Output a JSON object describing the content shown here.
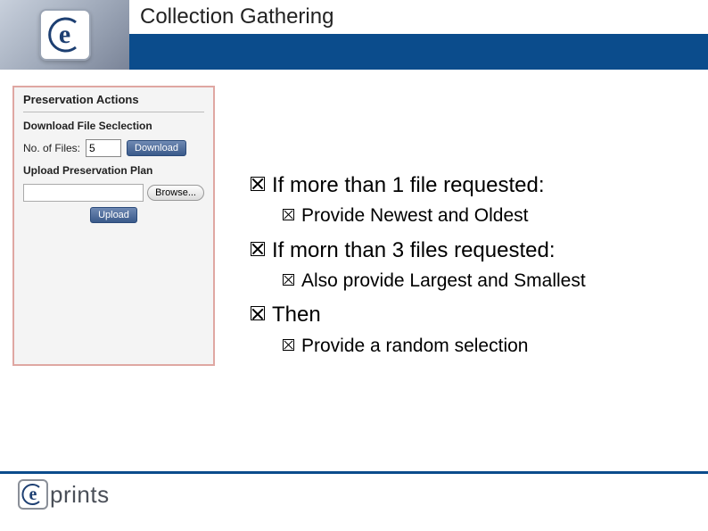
{
  "header": {
    "title": "Collection Gathering",
    "logo_letter": "e"
  },
  "panel": {
    "title": "Preservation Actions",
    "download_section": "Download File Seclection",
    "num_files_label": "No. of Files:",
    "num_files_value": "5",
    "download_btn": "Download",
    "upload_section": "Upload Preservation Plan",
    "browse_btn": "Browse...",
    "upload_btn": "Upload"
  },
  "bullets": [
    {
      "text": "If more than 1 file requested:",
      "sub": [
        "Provide Newest and Oldest"
      ]
    },
    {
      "text": "If morn than 3 files requested:",
      "sub": [
        "Also provide Largest and Smallest"
      ]
    },
    {
      "text": "Then",
      "sub": [
        "Provide a random selection"
      ]
    }
  ],
  "footer": {
    "logo_letter": "e",
    "brand": "prints"
  }
}
